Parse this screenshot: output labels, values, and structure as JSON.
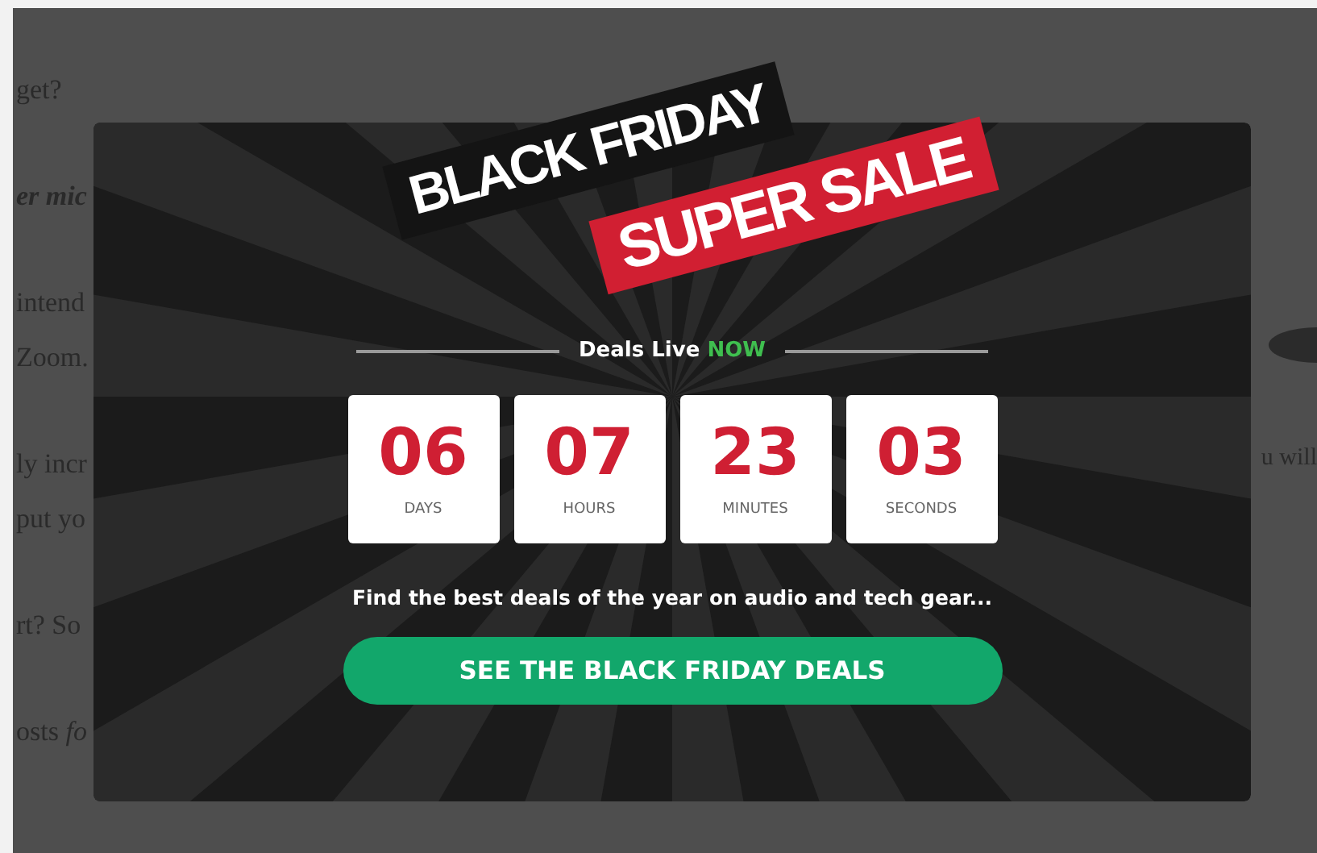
{
  "background_text": {
    "left_lines": [
      {
        "text": "get?",
        "kind": "plain"
      },
      {
        "text": "er mic",
        "kind": "emphasis"
      },
      {
        "text": "intend",
        "kind": "plain"
      },
      {
        "text": "Zoom.",
        "kind": "plain"
      },
      {
        "text": "ly incr",
        "kind": "plain"
      },
      {
        "text": "put yo",
        "kind": "plain"
      },
      {
        "text": "rt? So",
        "kind": "plain"
      },
      {
        "text": "osts *fo*",
        "kind": "plain"
      }
    ],
    "right_lines": [
      {
        "text": "u will"
      }
    ]
  },
  "popup": {
    "banner": {
      "line_1": "BLACK FRIDAY",
      "line_2": "SUPER SALE"
    },
    "headline": {
      "text": "Deals Live",
      "highlight": "NOW"
    },
    "countdown": [
      {
        "value": "06",
        "unit": "DAYS"
      },
      {
        "value": "07",
        "unit": "HOURS"
      },
      {
        "value": "23",
        "unit": "MINUTES"
      },
      {
        "value": "03",
        "unit": "SECONDS"
      }
    ],
    "tagline": "Find the best deals of the year on audio and tech gear...",
    "button": "SEE THE BLACK FRIDAY DEALS"
  }
}
